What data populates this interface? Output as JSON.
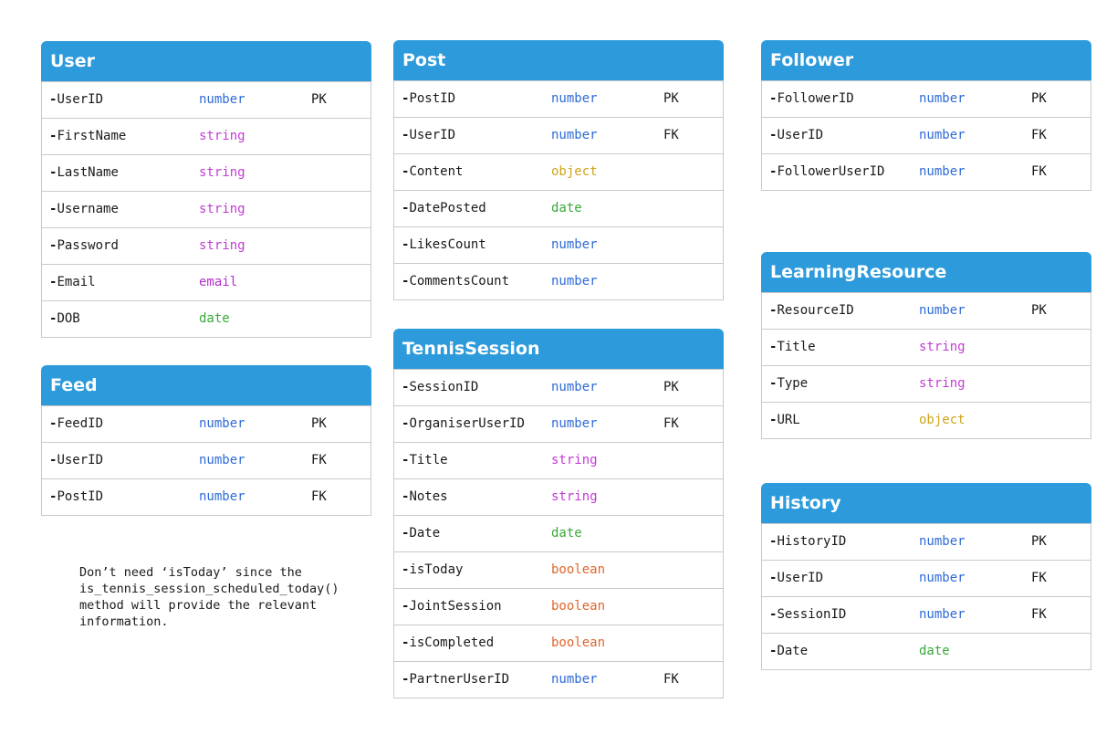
{
  "colors": {
    "header": "#2d9bdb",
    "number": "#2f6bd6",
    "string": "#c23bd4",
    "email": "#b42cd0",
    "date": "#3aa83a",
    "object": "#cfa41c",
    "boolean": "#e0662c"
  },
  "entities": {
    "user": {
      "title": "User",
      "fields": [
        {
          "name": "UserID",
          "type": "number",
          "key": "PK"
        },
        {
          "name": "FirstName",
          "type": "string",
          "key": ""
        },
        {
          "name": "LastName",
          "type": "string",
          "key": ""
        },
        {
          "name": "Username",
          "type": "string",
          "key": ""
        },
        {
          "name": "Password",
          "type": "string",
          "key": ""
        },
        {
          "name": "Email",
          "type": "email",
          "key": ""
        },
        {
          "name": "DOB",
          "type": "date",
          "key": ""
        }
      ]
    },
    "feed": {
      "title": "Feed",
      "fields": [
        {
          "name": "FeedID",
          "type": "number",
          "key": "PK"
        },
        {
          "name": "UserID",
          "type": "number",
          "key": "FK"
        },
        {
          "name": "PostID",
          "type": "number",
          "key": "FK"
        }
      ]
    },
    "post": {
      "title": "Post",
      "fields": [
        {
          "name": "PostID",
          "type": "number",
          "key": "PK"
        },
        {
          "name": "UserID",
          "type": "number",
          "key": "FK"
        },
        {
          "name": "Content",
          "type": "object",
          "key": ""
        },
        {
          "name": "DatePosted",
          "type": "date",
          "key": ""
        },
        {
          "name": "LikesCount",
          "type": "number",
          "key": ""
        },
        {
          "name": "CommentsCount",
          "type": "number",
          "key": ""
        }
      ]
    },
    "tennis_session": {
      "title": "TennisSession",
      "fields": [
        {
          "name": "SessionID",
          "type": "number",
          "key": "PK"
        },
        {
          "name": "OrganiserUserID",
          "type": "number",
          "key": "FK"
        },
        {
          "name": "Title",
          "type": "string",
          "key": ""
        },
        {
          "name": "Notes",
          "type": "string",
          "key": ""
        },
        {
          "name": "Date",
          "type": "date",
          "key": ""
        },
        {
          "name": "isToday",
          "type": "boolean",
          "key": ""
        },
        {
          "name": "JointSession",
          "type": "boolean",
          "key": ""
        },
        {
          "name": "isCompleted",
          "type": "boolean",
          "key": ""
        },
        {
          "name": "PartnerUserID",
          "type": "number",
          "key": "FK"
        }
      ]
    },
    "follower": {
      "title": "Follower",
      "fields": [
        {
          "name": "FollowerID",
          "type": "number",
          "key": "PK"
        },
        {
          "name": "UserID",
          "type": "number",
          "key": "FK"
        },
        {
          "name": "FollowerUserID",
          "type": "number",
          "key": "FK"
        }
      ]
    },
    "learning_resource": {
      "title": "LearningResource",
      "fields": [
        {
          "name": "ResourceID",
          "type": "number",
          "key": "PK"
        },
        {
          "name": "Title",
          "type": "string",
          "key": ""
        },
        {
          "name": "Type",
          "type": "string",
          "key": ""
        },
        {
          "name": "URL",
          "type": "object",
          "key": ""
        }
      ]
    },
    "history": {
      "title": "History",
      "fields": [
        {
          "name": "HistoryID",
          "type": "number",
          "key": "PK"
        },
        {
          "name": "UserID",
          "type": "number",
          "key": "FK"
        },
        {
          "name": "SessionID",
          "type": "number",
          "key": "FK"
        },
        {
          "name": "Date",
          "type": "date",
          "key": ""
        }
      ]
    }
  },
  "note": {
    "text": "Don’t need ‘isToday’ since the\nis_tennis_session_scheduled_today()\nmethod will provide the relevant\ninformation."
  }
}
